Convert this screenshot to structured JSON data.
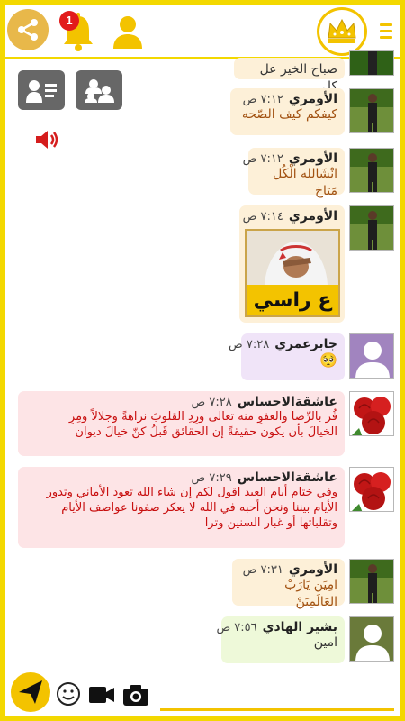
{
  "header": {
    "notification_count": "1",
    "icons": [
      "share-icon",
      "bell-icon",
      "user-icon",
      "crown-logo",
      "menu-icon"
    ]
  },
  "colors": {
    "frame": "#f3d800",
    "gold_bubble": "#fdf0d8",
    "purple_bubble": "#f0e4f8",
    "pink_bubble": "#fde4e6",
    "green_bubble": "#eef9d9",
    "name_red": "#c80f0f",
    "text_brown": "#a25212"
  },
  "messages": [
    {
      "text": "صباح الخير عل كل"
    },
    {
      "name": "الأومري",
      "time": "٧:١٢ ص",
      "text": "كيفكم كيف الصّحه"
    },
    {
      "name": "الأومري",
      "time": "٧:١٢ ص",
      "text": "انْشَالله الْكُل مَتاخ"
    },
    {
      "name": "الأومري",
      "time": "٧:١٤ ص",
      "sticker_text": "ع راسي"
    },
    {
      "name": "جابرعمري",
      "time": "٧:٢٨ ص",
      "emoji": "🥺"
    },
    {
      "name": "عاشقةالاحساس",
      "time": "٧:٢٨ ص",
      "lines": [
        "فُز بالرِّضا والعفوِ منه تعالى وزِدِ القلوبَ نزاهةً وجلالاً ومِرِ",
        "الخيالَ بأن يكون حقيقةً إن الحقائق قَبلُ كنّ خيالَ ديوان"
      ]
    },
    {
      "name": "عاشقةالاحساس",
      "time": "٧:٢٩ ص",
      "lines": [
        "وفي ختام أيام العيد اقول لكم إن شاء الله تعود الأماني وتدور",
        "الأيام بيننا ونحن أحبه في الله لا يعكر صفونا عواصف الأيام",
        "وتقلباتها أو غبار السنين وترا"
      ]
    },
    {
      "name": "الأومري",
      "time": "٧:٣١ ص",
      "text": "امِيَن يَارَبْ العَالَمِيَنْ"
    },
    {
      "name": "بشير الهادي",
      "time": "٧:٥٦ ص",
      "text": "امين"
    }
  ],
  "footer": {
    "icons": [
      "send-icon",
      "emoji-icon",
      "video-icon",
      "camera-icon"
    ]
  }
}
